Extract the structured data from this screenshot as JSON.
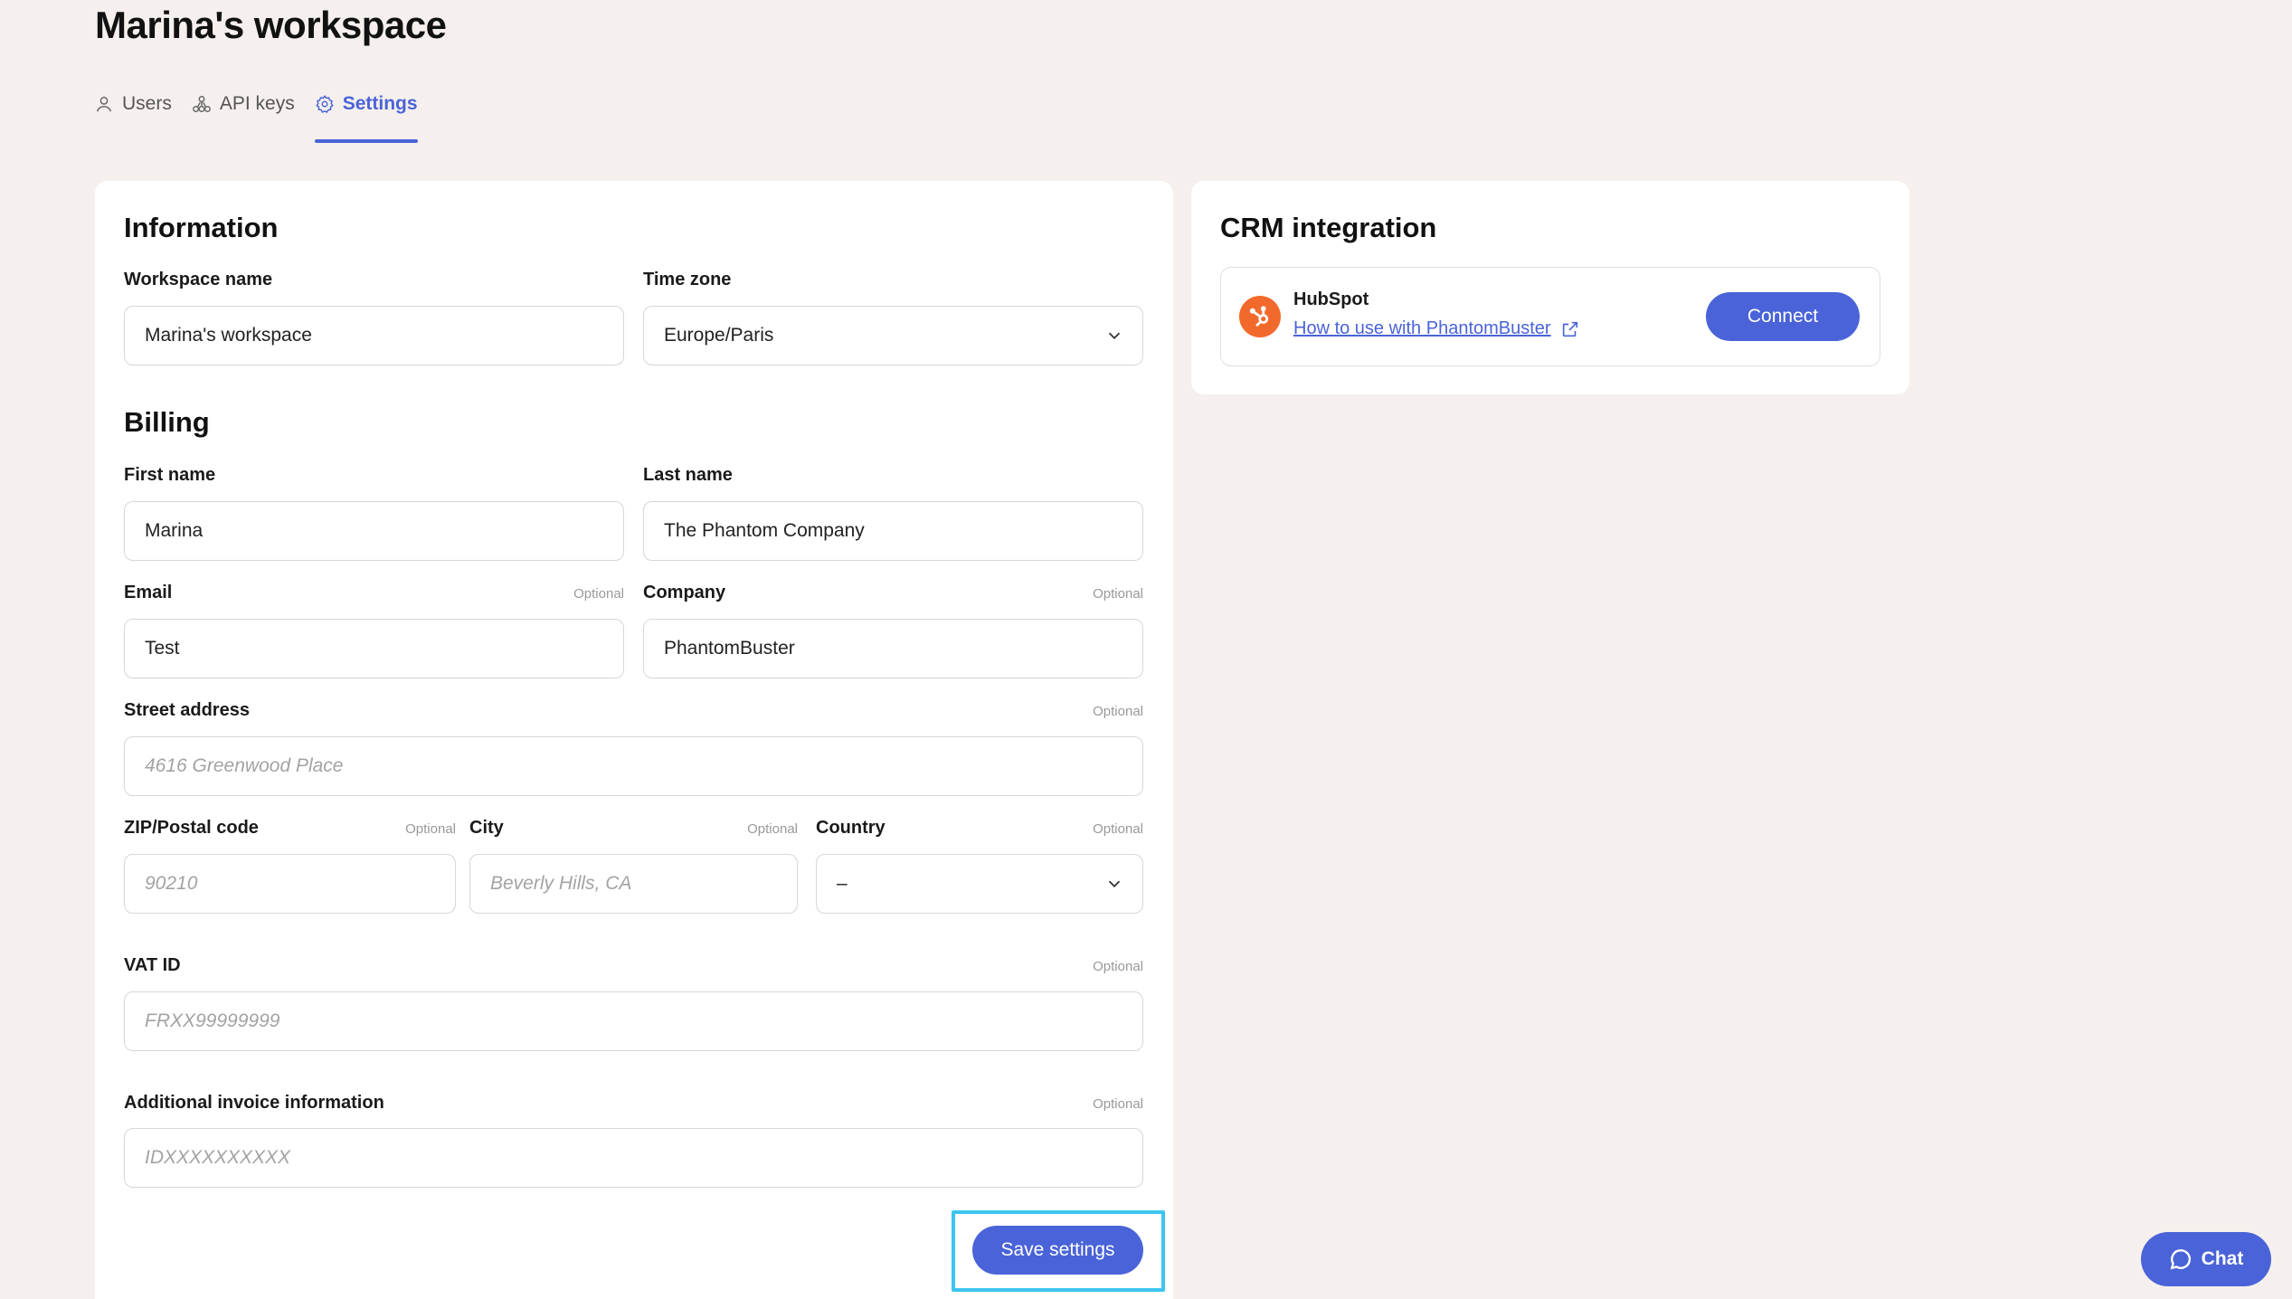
{
  "page": {
    "title": "Marina's workspace"
  },
  "tabs": [
    {
      "label": "Users",
      "icon": "user-icon",
      "active": false
    },
    {
      "label": "API keys",
      "icon": "api-network-icon",
      "active": false
    },
    {
      "label": "Settings",
      "icon": "gear-icon",
      "active": true
    }
  ],
  "information": {
    "title": "Information",
    "workspace_name": {
      "label": "Workspace name",
      "value": "Marina's workspace"
    },
    "time_zone": {
      "label": "Time zone",
      "value": "Europe/Paris"
    }
  },
  "billing": {
    "title": "Billing",
    "first_name": {
      "label": "First name",
      "value": "Marina"
    },
    "last_name": {
      "label": "Last name",
      "value": "The Phantom Company"
    },
    "email": {
      "label": "Email",
      "optional": "Optional",
      "value": "Test"
    },
    "company": {
      "label": "Company",
      "optional": "Optional",
      "value": "PhantomBuster"
    },
    "street": {
      "label": "Street address",
      "optional": "Optional",
      "placeholder": "4616 Greenwood Place"
    },
    "zip": {
      "label": "ZIP/Postal code",
      "optional": "Optional",
      "placeholder": "90210"
    },
    "city": {
      "label": "City",
      "optional": "Optional",
      "placeholder": "Beverly Hills, CA"
    },
    "country": {
      "label": "Country",
      "optional": "Optional",
      "value": "–"
    },
    "vat": {
      "label": "VAT ID",
      "optional": "Optional",
      "placeholder": "FRXX99999999"
    },
    "invoice_info": {
      "label": "Additional invoice information",
      "optional": "Optional",
      "placeholder": "IDXXXXXXXXXX"
    },
    "save_label": "Save settings"
  },
  "crm": {
    "title": "CRM integration",
    "provider": "HubSpot",
    "link_text": "How to use with PhantomBuster",
    "connect_label": "Connect"
  },
  "chat": {
    "label": "Chat"
  },
  "colors": {
    "accent": "#4a63d8",
    "hubspot": "#f26a2b",
    "highlight": "#3cc5ee",
    "background": "#f5f0ed"
  }
}
